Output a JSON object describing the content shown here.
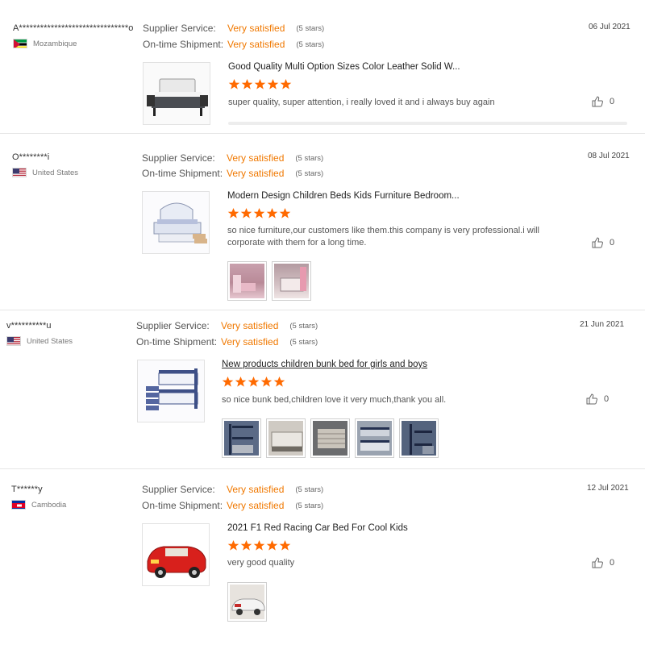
{
  "labels": {
    "supplier_service": "Supplier Service:",
    "on_time_shipment": "On-time Shipment:"
  },
  "colors": {
    "accent": "#f07800",
    "star": "#ff6a00"
  },
  "reviews": [
    {
      "user": "A*******************************o",
      "country": "Mozambique",
      "flag_icon": "mozambique-flag-icon",
      "supplier_service": {
        "value": "Very satisfied",
        "stars": "(5 stars)"
      },
      "on_time_shipment": {
        "value": "Very satisfied",
        "stars": "(5 stars)"
      },
      "date": "06 Jul 2021",
      "product_title": "Good Quality Multi Option Sizes Color Leather Solid W...",
      "rating": 5,
      "comment": "super quality, super attention, i really loved it and i always buy again",
      "likes": "0",
      "photo_count": 0
    },
    {
      "user": "O********i",
      "country": "United States",
      "flag_icon": "usa-flag-icon",
      "supplier_service": {
        "value": "Very satisfied",
        "stars": "(5 stars)"
      },
      "on_time_shipment": {
        "value": "Very satisfied",
        "stars": "(5 stars)"
      },
      "date": "08 Jul 2021",
      "product_title": "Modern Design Children Beds Kids Furniture Bedroom...",
      "rating": 5,
      "comment": "so nice furniture,our customers like them.this company is very professional.i will corporate with them for a long time.",
      "likes": "0",
      "photo_count": 2
    },
    {
      "user": "v**********u",
      "country": "United States",
      "flag_icon": "usa-flag-icon",
      "supplier_service": {
        "value": "Very satisfied",
        "stars": "(5 stars)"
      },
      "on_time_shipment": {
        "value": "Very satisfied",
        "stars": "(5 stars)"
      },
      "date": "21 Jun 2021",
      "product_title": "New products children bunk bed for girls and boys",
      "rating": 5,
      "comment": "so nice bunk bed,children love it very much,thank you all.",
      "likes": "0",
      "photo_count": 5
    },
    {
      "user": "T******y",
      "country": "Cambodia",
      "flag_icon": "cambodia-flag-icon",
      "supplier_service": {
        "value": "Very satisfied",
        "stars": "(5 stars)"
      },
      "on_time_shipment": {
        "value": "Very satisfied",
        "stars": "(5 stars)"
      },
      "date": "12 Jul 2021",
      "product_title": "2021 F1 Red Racing Car Bed For Cool Kids",
      "rating": 5,
      "comment": "very good quality",
      "likes": "0",
      "photo_count": 1
    }
  ]
}
